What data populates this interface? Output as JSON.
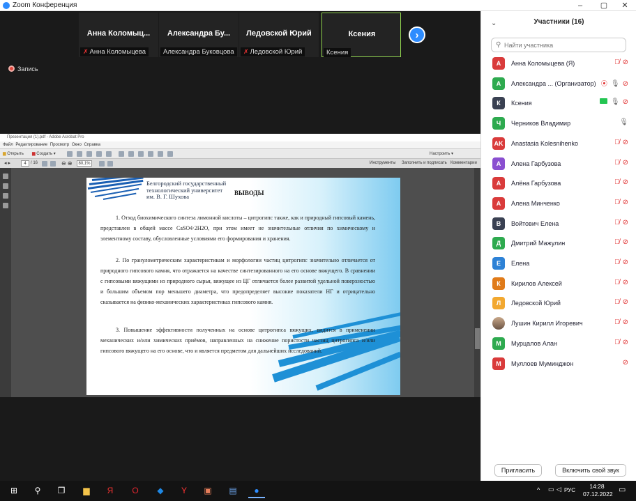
{
  "window": {
    "title": "Zoom Конференция",
    "minimize": "–",
    "maximize": "▢",
    "close": "✕"
  },
  "gallery": {
    "tiles": [
      {
        "name": "Анна Коломыц...",
        "label": "Анна Коломыцева",
        "muted": true,
        "active": false
      },
      {
        "name": "Александра Бу...",
        "label": "Александра Буковцова",
        "muted": false,
        "active": false
      },
      {
        "name": "Ледовской Юрий",
        "label": "Ледовской Юрий",
        "muted": true,
        "active": false
      },
      {
        "name": "Ксения",
        "label": "Ксения",
        "muted": false,
        "active": true
      }
    ],
    "next": "›"
  },
  "recording": {
    "label": "Запись"
  },
  "acrobat": {
    "title": "Презентация (1).pdf - Adobe Acrobat Pro",
    "menu": "Файл Редактирование Просмотр Окно Справка",
    "open": "Открыть",
    "create": "Создать ▾",
    "customize": "Настроить ▾",
    "page_current": "4",
    "page_total": "/ 16",
    "zoom": "80,1%",
    "tools": "Инструменты",
    "sign": "Заполнить и подписать",
    "comments": "Комментарии"
  },
  "slide": {
    "university": [
      "Белгородский государственный",
      "технологический университет",
      "им. В. Г. Шухова"
    ],
    "heading": "ВЫВОДЫ",
    "paragraphs": [
      "1. Отход биохимического синтеза лимонной кислоты – цитрогипс также, как и природный гипсовый камень, представлен в общей массе CaSO4·2H2O, при этом имеет не значительные отличия по химическому и элементному составу, обусловленные условиями его формирования и хранения.",
      "2. По гранулометрическим характеристикам и морфологии частиц цитрогипс значительно отличается от природного гипсового камня, что отражается на качестве синтезированного на его основе вяжущего. В сравнении с гипсовыми вяжущими из природного сырья, вяжущее из ЦГ отличается более развитой удельной поверхностью и большим объемом пор меньшего диаметра, что предопределяет высокие показатели НГ и отрицательно сказывается на физико-механических характеристиках гипсового камня.",
      "3. Повышение эффективности полученных на основе цитрогипса вяжущих, видится в применении механических и/или химических приёмов, направленных на снижение пористости частиц цитрогипса и/или гипсового вяжущего на его основе, что и является предметом для дальнейших исследований."
    ]
  },
  "participants": {
    "title": "Участники (16)",
    "search_placeholder": "Найти участника",
    "list": [
      {
        "initial": "А",
        "name": "Анна Коломыцева (Я)",
        "color": "#d93b3b",
        "mic": "off",
        "cam": "off"
      },
      {
        "initial": "А",
        "name": "Александра ... (Организатор)",
        "color": "#2eaa4f",
        "mic": "on",
        "cam": "off",
        "rec": true
      },
      {
        "initial": "К",
        "name": "Ксения",
        "color": "#3a4152",
        "mic": "on",
        "cam": "off",
        "share": true
      },
      {
        "initial": "Ч",
        "name": "Черников Владимир",
        "color": "#2eaa4f",
        "mic": "on",
        "cam": "none"
      },
      {
        "initial": "AK",
        "name": "Anastasia Kolesnihenko",
        "color": "#d93b3b",
        "mic": "off",
        "cam": "off"
      },
      {
        "initial": "А",
        "name": "Алена Гарбузова",
        "color": "#8a4fd0",
        "mic": "off",
        "cam": "off"
      },
      {
        "initial": "А",
        "name": "Алёна Гарбузова",
        "color": "#d93b3b",
        "mic": "off",
        "cam": "off"
      },
      {
        "initial": "А",
        "name": "Алена Минченко",
        "color": "#d93b3b",
        "mic": "off",
        "cam": "off"
      },
      {
        "initial": "В",
        "name": "Войтович Елена",
        "color": "#3a4152",
        "mic": "off",
        "cam": "off"
      },
      {
        "initial": "Д",
        "name": "Дмитрий Мажулин",
        "color": "#2eaa4f",
        "mic": "off",
        "cam": "off"
      },
      {
        "initial": "Е",
        "name": "Елена",
        "color": "#2e82d6",
        "mic": "off",
        "cam": "off"
      },
      {
        "initial": "К",
        "name": "Кирилов Алексей",
        "color": "#e07b1a",
        "mic": "off",
        "cam": "off"
      },
      {
        "initial": "Л",
        "name": "Ледовской Юрий",
        "color": "#f2a830",
        "mic": "off",
        "cam": "off"
      },
      {
        "initial": "",
        "name": "Лушин Кирилл Игоревич",
        "color": "#8f7a66",
        "mic": "off",
        "cam": "off",
        "photo": true
      },
      {
        "initial": "М",
        "name": "Мурцалов Алан",
        "color": "#2eaa4f",
        "mic": "off",
        "cam": "off"
      },
      {
        "initial": "М",
        "name": "Муллоев Муминджон",
        "color": "#d93b3b",
        "mic": "none",
        "cam": "off"
      }
    ],
    "invite_label": "Пригласить",
    "unmute_label": "Включить свой звук"
  },
  "taskbar": {
    "lang": "РУС",
    "time": "14:28",
    "date": "07.12.2022",
    "apps": [
      {
        "name": "windows-start-icon",
        "glyph": "⊞",
        "color": "#ffffff"
      },
      {
        "name": "search-icon",
        "glyph": "⚲",
        "color": "#ffffff"
      },
      {
        "name": "task-view-icon",
        "glyph": "❐",
        "color": "#ffffff"
      },
      {
        "name": "file-explorer-icon",
        "glyph": "▆",
        "color": "#f3c34a"
      },
      {
        "name": "yandex-icon",
        "glyph": "Я",
        "color": "#e8312f"
      },
      {
        "name": "opera-icon",
        "glyph": "O",
        "color": "#e3262f"
      },
      {
        "name": "defender-icon",
        "glyph": "◆",
        "color": "#1e88e5"
      },
      {
        "name": "yandex-browser-icon",
        "glyph": "Y",
        "color": "#ff3333"
      },
      {
        "name": "photos-icon",
        "glyph": "▣",
        "color": "#e67e5a"
      },
      {
        "name": "notepad-icon",
        "glyph": "▤",
        "color": "#6aa0e6"
      },
      {
        "name": "zoom-app-icon",
        "glyph": "●",
        "color": "#2d8cff"
      }
    ]
  }
}
